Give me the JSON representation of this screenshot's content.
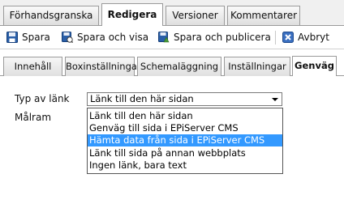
{
  "tabs": [
    {
      "label": "Förhandsgranska",
      "active": false
    },
    {
      "label": "Redigera",
      "active": true
    },
    {
      "label": "Versioner",
      "active": false
    },
    {
      "label": "Kommentarer",
      "active": false
    }
  ],
  "toolbar": {
    "save_label": "Spara",
    "save_view_label": "Spara och visa",
    "save_publish_label": "Spara och publicera",
    "cancel_label": "Avbryt"
  },
  "subtabs": [
    {
      "label": "Innehåll",
      "active": false
    },
    {
      "label": "Boxinställningar",
      "active": false
    },
    {
      "label": "Schemaläggning",
      "active": false
    },
    {
      "label": "Inställningar",
      "active": false
    },
    {
      "label": "Genväg",
      "active": true
    }
  ],
  "form": {
    "link_type_label": "Typ av länk",
    "target_label": "Målram",
    "link_type_value": "Länk till den här sidan",
    "options": [
      "Länk till den här sidan",
      "Genväg till sida i EPiServer CMS",
      "Hämta data från sida i EPiServer CMS",
      "Länk till sida på annan webbplats",
      "Ingen länk, bara text"
    ],
    "highlighted_index": 2
  },
  "colors": {
    "highlight": "#3399ff",
    "save_icon": "#2a5fa8",
    "cancel_icon": "#3a6fc0"
  }
}
